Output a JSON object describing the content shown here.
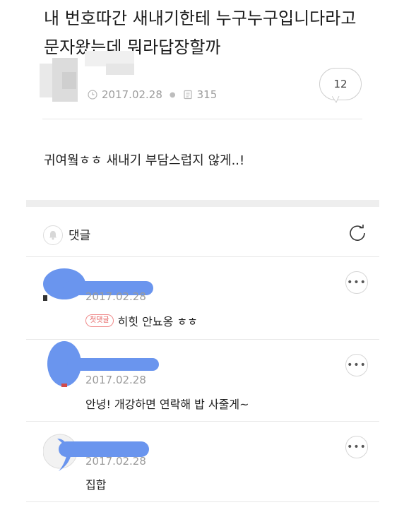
{
  "post": {
    "title": "내 번호따간 새내기한테 누구누구입니다라고 문자왔는데 뭐라답장할까",
    "date": "2017.02.28",
    "views": "315",
    "comment_count": "12",
    "body": "귀여웤ㅎㅎ 새내기 부담스럽지 않게..!"
  },
  "comments_section": {
    "label": "댓글"
  },
  "comments": [
    {
      "date": "2017.02.28",
      "badge": "첫댓글",
      "text": "히힛 안뇨옹 ㅎㅎ"
    },
    {
      "date": "2017.02.28",
      "badge": "",
      "text": "안녕! 개강하면 연락해 밥 사줄게~"
    },
    {
      "date": "2017.02.28",
      "badge": "",
      "text": "집합"
    }
  ],
  "colors": {
    "redaction": "#6a95ee",
    "badge": "#e35a5a",
    "meta": "#9d9d9d"
  },
  "icons": {
    "clock": "clock-icon",
    "doc": "document-icon",
    "bell": "bell-icon",
    "refresh": "refresh-icon",
    "more": "more-icon"
  }
}
